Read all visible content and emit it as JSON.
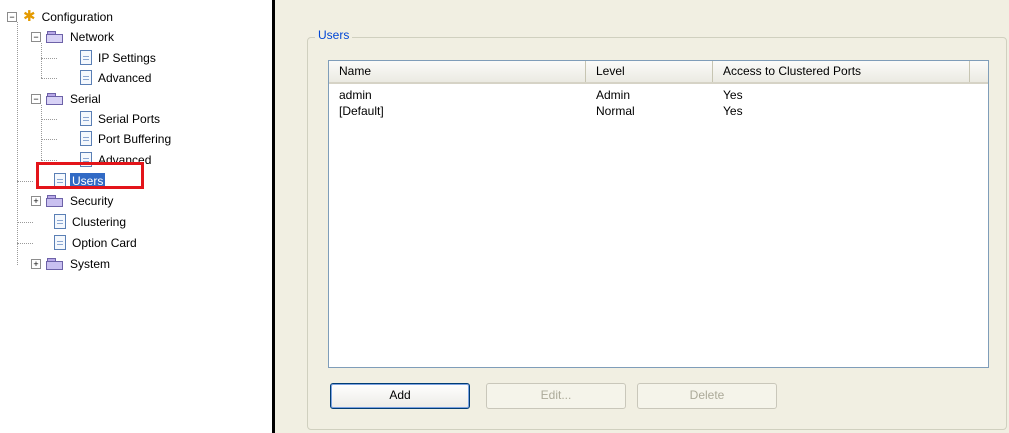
{
  "tree": {
    "root": "Configuration",
    "network": "Network",
    "ip_settings": "IP Settings",
    "network_advanced": "Advanced",
    "serial": "Serial",
    "serial_ports": "Serial Ports",
    "port_buffering": "Port Buffering",
    "serial_advanced": "Advanced",
    "users": "Users",
    "security": "Security",
    "clustering": "Clustering",
    "option_card": "Option Card",
    "system": "System",
    "selected": "Users"
  },
  "users_panel": {
    "group_title": "Users",
    "columns": [
      "Name",
      "Level",
      "Access to Clustered Ports"
    ],
    "rows": [
      {
        "name": "admin",
        "level": "Admin",
        "access": "Yes"
      },
      {
        "name": "[Default]",
        "level": "Normal",
        "access": "Yes"
      }
    ],
    "buttons": {
      "add": "Add",
      "edit": "Edit...",
      "delete": "Delete"
    }
  },
  "colors": {
    "selection": "#316ac5",
    "highlight_box": "#e3141a",
    "group_title": "#0046d5",
    "panel_background": "#f1efe2"
  }
}
